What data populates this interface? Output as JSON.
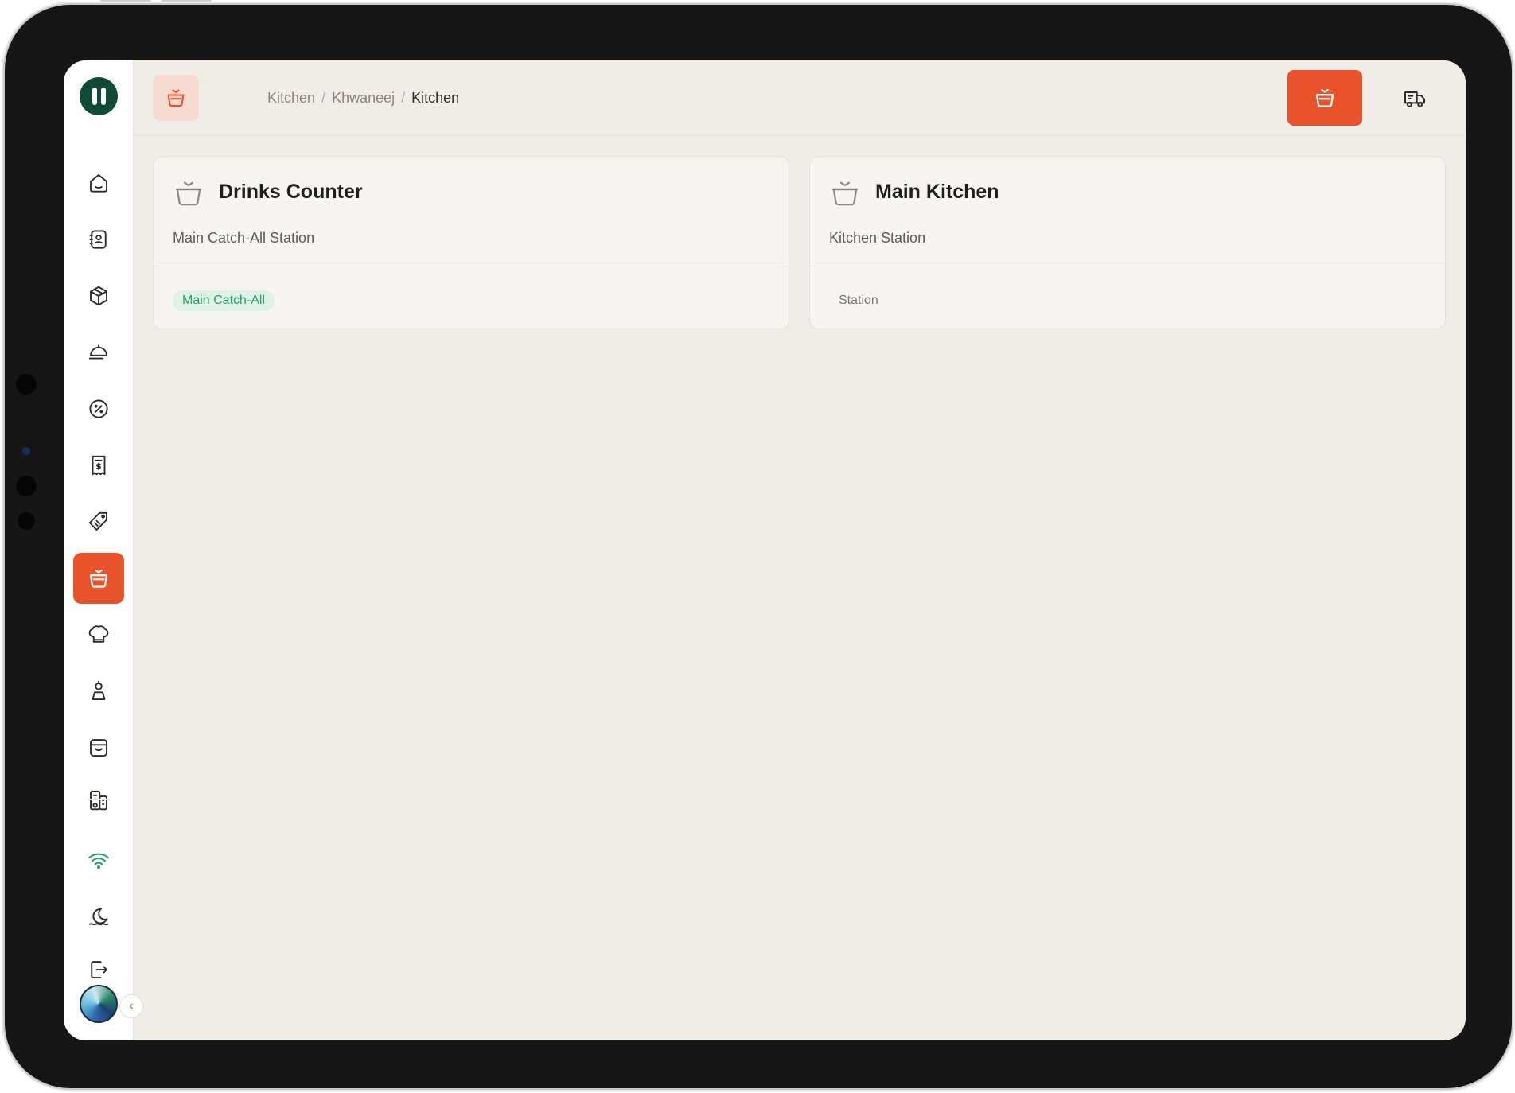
{
  "app": {
    "logo_name": "pause-logo"
  },
  "header": {
    "breadcrumb": [
      "Kitchen",
      "Khwaneej",
      "Kitchen"
    ],
    "separator": "/"
  },
  "sidebar": {
    "items": [
      {
        "icon": "home-icon"
      },
      {
        "icon": "contacts-icon"
      },
      {
        "icon": "box-icon"
      },
      {
        "icon": "dish-icon"
      },
      {
        "icon": "discount-icon"
      },
      {
        "icon": "receipt-icon"
      },
      {
        "icon": "tag-icon"
      },
      {
        "icon": "kitchen-pot-icon",
        "active": true
      },
      {
        "icon": "chef-hat-icon"
      },
      {
        "icon": "staff-icon"
      },
      {
        "icon": "store-icon"
      },
      {
        "icon": "buildings-icon"
      },
      {
        "icon": "wifi-icon"
      },
      {
        "icon": "theme-icon"
      },
      {
        "icon": "logout-icon"
      }
    ]
  },
  "stations": [
    {
      "title": "Drinks Counter",
      "subtitle": "Main Catch-All Station",
      "badge": "Main Catch-All",
      "badge_style": "green"
    },
    {
      "title": "Main Kitchen",
      "subtitle": "Kitchen Station",
      "badge": "Station",
      "badge_style": "plain"
    }
  ],
  "colors": {
    "accent": "#e8532b",
    "background": "#f0ece8",
    "success": "#22a566",
    "logo": "#114b35"
  }
}
